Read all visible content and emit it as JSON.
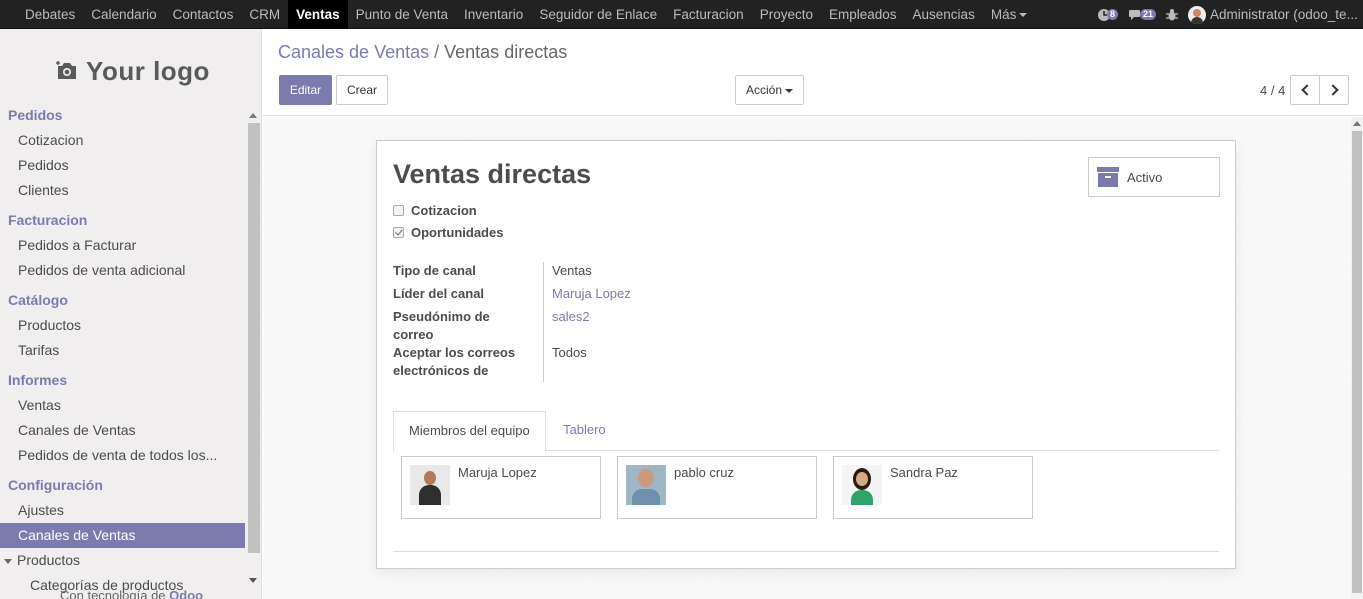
{
  "topbar": {
    "menu": [
      "Debates",
      "Calendario",
      "Contactos",
      "CRM",
      "Ventas",
      "Punto de Venta",
      "Inventario",
      "Seguidor de Enlace",
      "Facturacion",
      "Proyecto",
      "Empleados",
      "Ausencias",
      "Más"
    ],
    "active_index": 4,
    "activity_count": "8",
    "messages_count": "21",
    "user_name": "Administrator (odoo_te..."
  },
  "sidebar": {
    "logo_text": "Your logo",
    "sections": [
      {
        "title": "Pedidos",
        "items": [
          "Cotizacion",
          "Pedidos",
          "Clientes"
        ]
      },
      {
        "title": "Facturacion",
        "items": [
          "Pedidos a Facturar",
          "Pedidos de venta adicional"
        ]
      },
      {
        "title": "Catálogo",
        "items": [
          "Productos",
          "Tarifas"
        ]
      },
      {
        "title": "Informes",
        "items": [
          "Ventas",
          "Canales de Ventas",
          "Pedidos de venta de todos los..."
        ]
      },
      {
        "title": "Configuración",
        "items": [
          "Ajustes",
          "Canales de Ventas",
          "Productos",
          "Categorías de productos"
        ]
      }
    ],
    "powered_prefix": "Con tecnología de",
    "powered_brand": "Odoo"
  },
  "control_panel": {
    "breadcrumb_parent": "Canales de Ventas",
    "breadcrumb_sep": "/",
    "breadcrumb_current": "Ventas directas",
    "edit_label": "Editar",
    "create_label": "Crear",
    "action_label": "Acción",
    "pager": "4 / 4"
  },
  "form": {
    "title": "Ventas directas",
    "checkbox_quotation": {
      "label": "Cotizacion",
      "checked": false
    },
    "checkbox_opportunities": {
      "label": "Oportunidades",
      "checked": true
    },
    "active_button": "Activo",
    "fields": {
      "channel_type": {
        "label": "Tipo de canal",
        "value": "Ventas"
      },
      "channel_leader": {
        "label": "Líder del canal",
        "value": "Maruja Lopez"
      },
      "email_alias": {
        "label_line1": "Pseudónimo de",
        "label_line2": "correo",
        "value": "sales2"
      },
      "accept_emails": {
        "label_line1": "Aceptar los correos",
        "label_line2": "electrónicos de",
        "value": "Todos"
      }
    },
    "tabs": [
      "Miembros del equipo",
      "Tablero"
    ],
    "members": [
      "Maruja Lopez",
      "pablo cruz",
      "Sandra Paz"
    ]
  },
  "colors": {
    "accent": "#7c7bad",
    "navbar": "#222222",
    "sidebar_bg": "#f0eeee"
  }
}
